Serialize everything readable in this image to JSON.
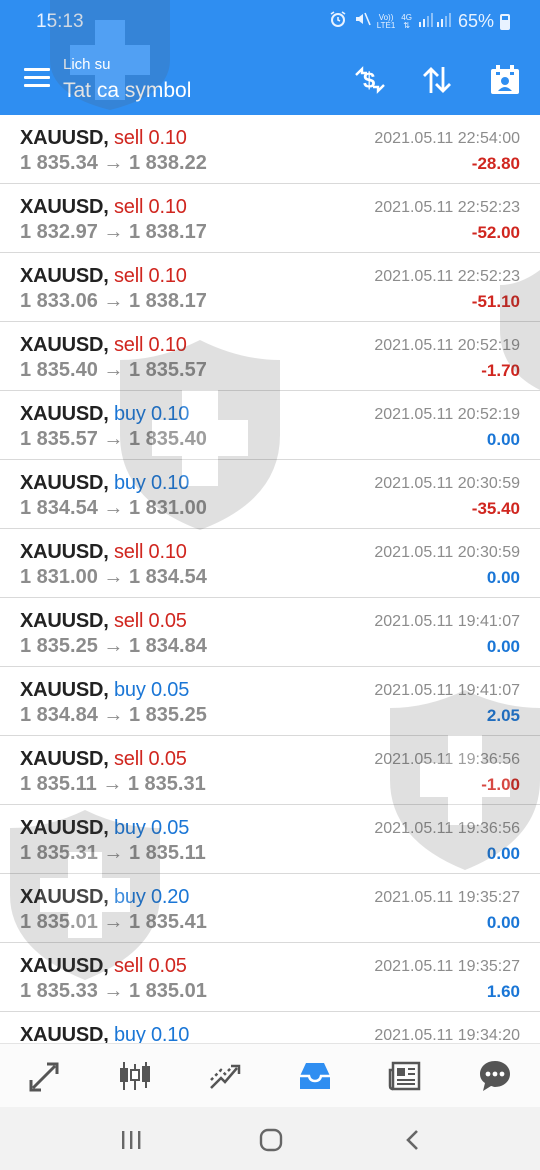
{
  "status_bar": {
    "time": "15:13",
    "carrier_top": "Vo))",
    "carrier_bottom": "LTE1",
    "network_top": "4G",
    "network_bottom": "",
    "battery": "65%"
  },
  "header": {
    "subtitle": "Lich su",
    "title": "Tat ca symbol",
    "icons": [
      "currency-sort-icon",
      "sort-icon",
      "calendar-icon"
    ]
  },
  "trades": [
    {
      "symbol": "XAUUSD,",
      "type": "sell 0.10",
      "side": "sell",
      "open": "1 835.34",
      "arrow": "→",
      "close": "1 838.22",
      "time": "2021.05.11 22:54:00",
      "profit": "-28.80",
      "profit_sign": "neg"
    },
    {
      "symbol": "XAUUSD,",
      "type": "sell 0.10",
      "side": "sell",
      "open": "1 832.97",
      "arrow": "→",
      "close": "1 838.17",
      "time": "2021.05.11 22:52:23",
      "profit": "-52.00",
      "profit_sign": "neg"
    },
    {
      "symbol": "XAUUSD,",
      "type": "sell 0.10",
      "side": "sell",
      "open": "1 833.06",
      "arrow": "→",
      "close": "1 838.17",
      "time": "2021.05.11 22:52:23",
      "profit": "-51.10",
      "profit_sign": "neg"
    },
    {
      "symbol": "XAUUSD,",
      "type": "sell 0.10",
      "side": "sell",
      "open": "1 835.40",
      "arrow": "→",
      "close": "1 835.57",
      "time": "2021.05.11 20:52:19",
      "profit": "-1.70",
      "profit_sign": "neg"
    },
    {
      "symbol": "XAUUSD,",
      "type": "buy 0.10",
      "side": "buy",
      "open": "1 835.57",
      "arrow": "→",
      "close": "1 835.40",
      "time": "2021.05.11 20:52:19",
      "profit": "0.00",
      "profit_sign": "pos"
    },
    {
      "symbol": "XAUUSD,",
      "type": "buy 0.10",
      "side": "buy",
      "open": "1 834.54",
      "arrow": "→",
      "close": "1 831.00",
      "time": "2021.05.11 20:30:59",
      "profit": "-35.40",
      "profit_sign": "neg"
    },
    {
      "symbol": "XAUUSD,",
      "type": "sell 0.10",
      "side": "sell",
      "open": "1 831.00",
      "arrow": "→",
      "close": "1 834.54",
      "time": "2021.05.11 20:30:59",
      "profit": "0.00",
      "profit_sign": "pos"
    },
    {
      "symbol": "XAUUSD,",
      "type": "sell 0.05",
      "side": "sell",
      "open": "1 835.25",
      "arrow": "→",
      "close": "1 834.84",
      "time": "2021.05.11 19:41:07",
      "profit": "0.00",
      "profit_sign": "pos"
    },
    {
      "symbol": "XAUUSD,",
      "type": "buy 0.05",
      "side": "buy",
      "open": "1 834.84",
      "arrow": "→",
      "close": "1 835.25",
      "time": "2021.05.11 19:41:07",
      "profit": "2.05",
      "profit_sign": "pos"
    },
    {
      "symbol": "XAUUSD,",
      "type": "sell 0.05",
      "side": "sell",
      "open": "1 835.11",
      "arrow": "→",
      "close": "1 835.31",
      "time": "2021.05.11 19:36:56",
      "profit": "-1.00",
      "profit_sign": "neg"
    },
    {
      "symbol": "XAUUSD,",
      "type": "buy 0.05",
      "side": "buy",
      "open": "1 835.31",
      "arrow": "→",
      "close": "1 835.11",
      "time": "2021.05.11 19:36:56",
      "profit": "0.00",
      "profit_sign": "pos"
    },
    {
      "symbol": "XAUUSD,",
      "type": "buy 0.20",
      "side": "buy",
      "open": "1 835.01",
      "arrow": "→",
      "close": "1 835.41",
      "time": "2021.05.11 19:35:27",
      "profit": "0.00",
      "profit_sign": "pos"
    },
    {
      "symbol": "XAUUSD,",
      "type": "sell 0.05",
      "side": "sell",
      "open": "1 835.33",
      "arrow": "→",
      "close": "1 835.01",
      "time": "2021.05.11 19:35:27",
      "profit": "1.60",
      "profit_sign": "pos"
    },
    {
      "symbol": "XAUUSD,",
      "type": "buy 0.10",
      "side": "buy",
      "open": "",
      "arrow": "",
      "close": "",
      "time": "2021.05.11 19:34:20",
      "profit": "",
      "profit_sign": "pos"
    }
  ],
  "bottom_nav": [
    "quotes-icon",
    "chart-icon",
    "trade-icon",
    "history-icon",
    "news-icon",
    "chat-icon"
  ],
  "active_tab": "history-icon",
  "system_nav": [
    "recent-apps-icon",
    "home-icon",
    "back-icon"
  ],
  "colors": {
    "header": "#2f8ef1",
    "sell": "#d0261f",
    "buy": "#1a76d6",
    "muted": "#8c8c8c",
    "active_tab": "#2f8ef1"
  }
}
